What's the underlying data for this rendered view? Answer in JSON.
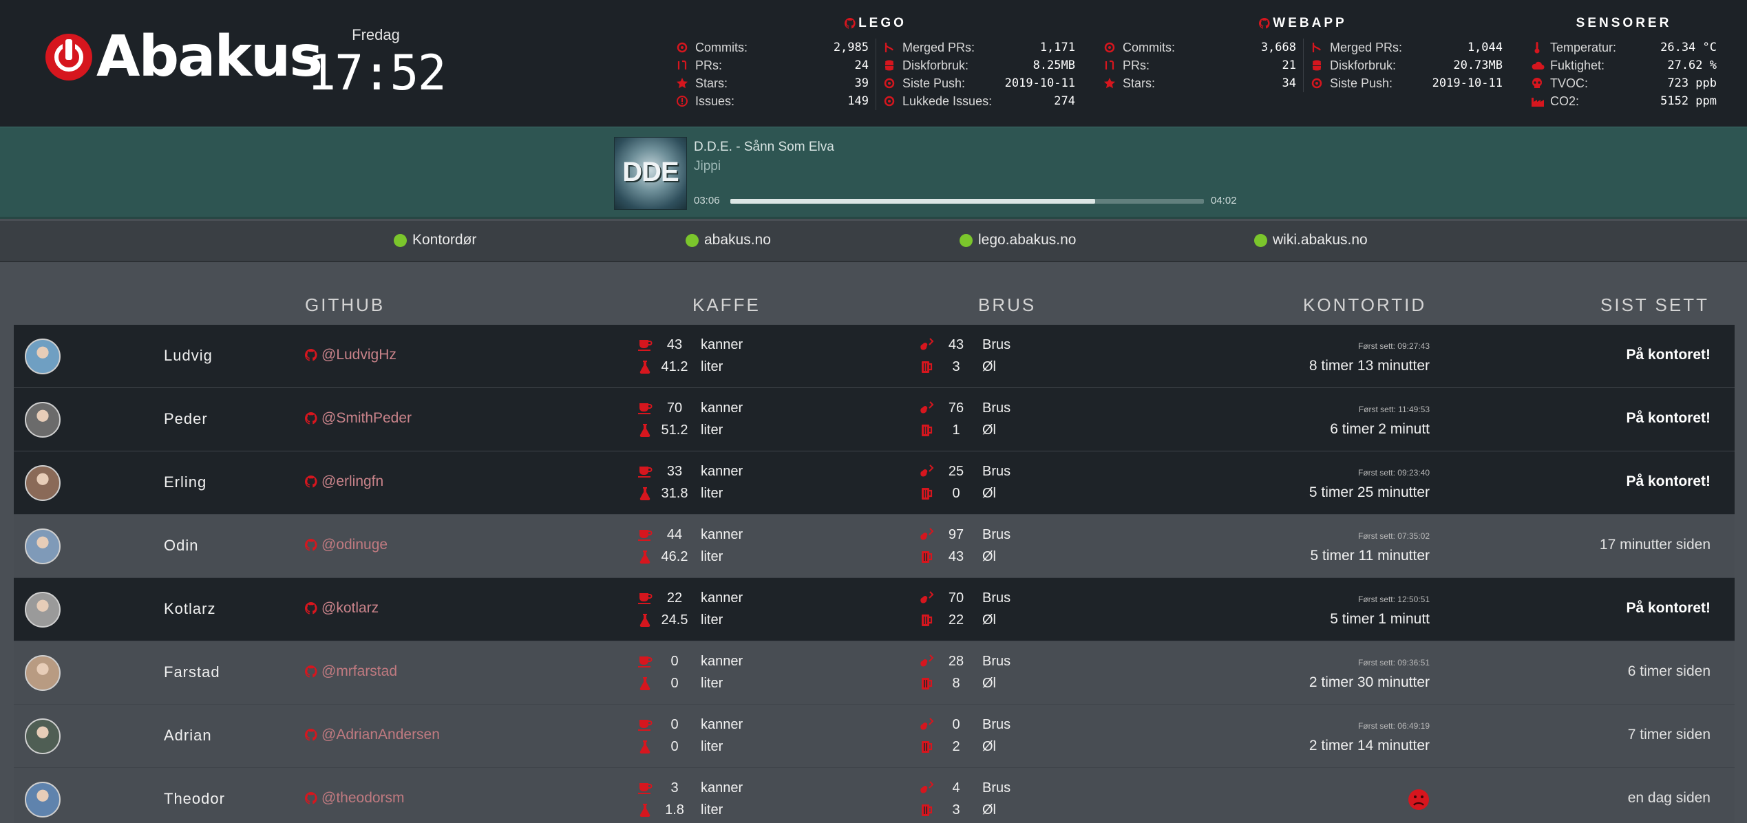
{
  "brand": {
    "name": "Abakus"
  },
  "clock": {
    "day": "Fredag",
    "time": "17:52"
  },
  "panels": {
    "lego": {
      "title": "LEGO",
      "left": [
        {
          "icon": "commit-icon",
          "label": "Commits:",
          "value": "2,985"
        },
        {
          "icon": "pull-request-icon",
          "label": "PRs:",
          "value": "24"
        },
        {
          "icon": "star-icon",
          "label": "Stars:",
          "value": "39"
        },
        {
          "icon": "issue-icon",
          "label": "Issues:",
          "value": "149"
        }
      ],
      "right": [
        {
          "icon": "merge-icon",
          "label": "Merged PRs:",
          "value": "1,171"
        },
        {
          "icon": "database-icon",
          "label": "Diskforbruk:",
          "value": "8.25MB"
        },
        {
          "icon": "commit-icon",
          "label": "Siste Push:",
          "value": "2019-10-11"
        },
        {
          "icon": "commit-icon",
          "label": "Lukkede Issues:",
          "value": "274"
        }
      ]
    },
    "webapp": {
      "title": "WEBAPP",
      "left": [
        {
          "icon": "commit-icon",
          "label": "Commits:",
          "value": "3,668"
        },
        {
          "icon": "pull-request-icon",
          "label": "PRs:",
          "value": "21"
        },
        {
          "icon": "star-icon",
          "label": "Stars:",
          "value": "34"
        }
      ],
      "right": [
        {
          "icon": "merge-icon",
          "label": "Merged PRs:",
          "value": "1,044"
        },
        {
          "icon": "database-icon",
          "label": "Diskforbruk:",
          "value": "20.73MB"
        },
        {
          "icon": "commit-icon",
          "label": "Siste Push:",
          "value": "2019-10-11"
        }
      ]
    },
    "sensors": {
      "title": "SENSORER",
      "items": [
        {
          "icon": "thermometer-icon",
          "label": "Temperatur:",
          "value": "26.34 °C"
        },
        {
          "icon": "cloud-icon",
          "label": "Fuktighet:",
          "value": "27.62 %"
        },
        {
          "icon": "skull-icon",
          "label": "TVOC:",
          "value": "723 ppb"
        },
        {
          "icon": "factory-icon",
          "label": "CO2:",
          "value": "5152 ppm"
        }
      ]
    }
  },
  "player": {
    "cover_text": "DDE",
    "song": "D.D.E. - Sånn Som Elva",
    "artist": "Jippi",
    "current": "03:06",
    "total": "04:02",
    "progress": 0.77
  },
  "status_items": [
    {
      "label": "Kontordør",
      "color": "#7bc62c"
    },
    {
      "label": "abakus.no",
      "color": "#7bc62c"
    },
    {
      "label": "lego.abakus.no",
      "color": "#7bc62c"
    },
    {
      "label": "wiki.abakus.no",
      "color": "#7bc62c"
    }
  ],
  "table": {
    "headers": {
      "github": "GITHUB",
      "kaffe": "KAFFE",
      "brus": "BRUS",
      "kontortid": "KONTORTID",
      "sist_sett": "SIST SETT"
    },
    "units": {
      "kanner": "kanner",
      "liter": "liter",
      "brus": "Brus",
      "ol": "Øl"
    },
    "rows": [
      {
        "name": "Ludvig",
        "github": "@LudvigHz",
        "kanner": "43",
        "liter": "41.2",
        "brus": "43",
        "ol": "3",
        "first_seen": "Først sett: 09:27:43",
        "duration": "8 timer 13 minutter",
        "last_seen": "På kontoret!",
        "present": true,
        "avatar": "#6f9fc2"
      },
      {
        "name": "Peder",
        "github": "@SmithPeder",
        "kanner": "70",
        "liter": "51.2",
        "brus": "76",
        "ol": "1",
        "first_seen": "Først sett: 11:49:53",
        "duration": "6 timer 2 minutt",
        "last_seen": "På kontoret!",
        "present": true,
        "avatar": "#6b6b6b"
      },
      {
        "name": "Erling",
        "github": "@erlingfn",
        "kanner": "33",
        "liter": "31.8",
        "brus": "25",
        "ol": "0",
        "first_seen": "Først sett: 09:23:40",
        "duration": "5 timer 25 minutter",
        "last_seen": "På kontoret!",
        "present": true,
        "avatar": "#8a6a58"
      },
      {
        "name": "Odin",
        "github": "@odinuge",
        "kanner": "44",
        "liter": "46.2",
        "brus": "97",
        "ol": "43",
        "first_seen": "Først sett: 07:35:02",
        "duration": "5 timer 11 minutter",
        "last_seen": "17 minutter siden",
        "present": false,
        "avatar": "#7f9ab8"
      },
      {
        "name": "Kotlarz",
        "github": "@kotlarz",
        "kanner": "22",
        "liter": "24.5",
        "brus": "70",
        "ol": "22",
        "first_seen": "Først sett: 12:50:51",
        "duration": "5 timer 1 minutt",
        "last_seen": "På kontoret!",
        "present": true,
        "avatar": "#9a9a9a"
      },
      {
        "name": "Farstad",
        "github": "@mrfarstad",
        "kanner": "0",
        "liter": "0",
        "brus": "28",
        "ol": "8",
        "first_seen": "Først sett: 09:36:51",
        "duration": "2 timer 30 minutter",
        "last_seen": "6 timer siden",
        "present": false,
        "avatar": "#b89b82"
      },
      {
        "name": "Adrian",
        "github": "@AdrianAndersen",
        "kanner": "0",
        "liter": "0",
        "brus": "0",
        "ol": "2",
        "first_seen": "Først sett: 06:49:19",
        "duration": "2 timer 14 minutter",
        "last_seen": "7 timer siden",
        "present": false,
        "avatar": "#4f5e54"
      },
      {
        "name": "Theodor",
        "github": "@theodorsm",
        "kanner": "3",
        "liter": "1.8",
        "brus": "4",
        "ol": "3",
        "first_seen": "",
        "duration": "",
        "last_seen": "en dag siden",
        "present": false,
        "avatar": "#5f83ad",
        "sad": true
      }
    ]
  }
}
